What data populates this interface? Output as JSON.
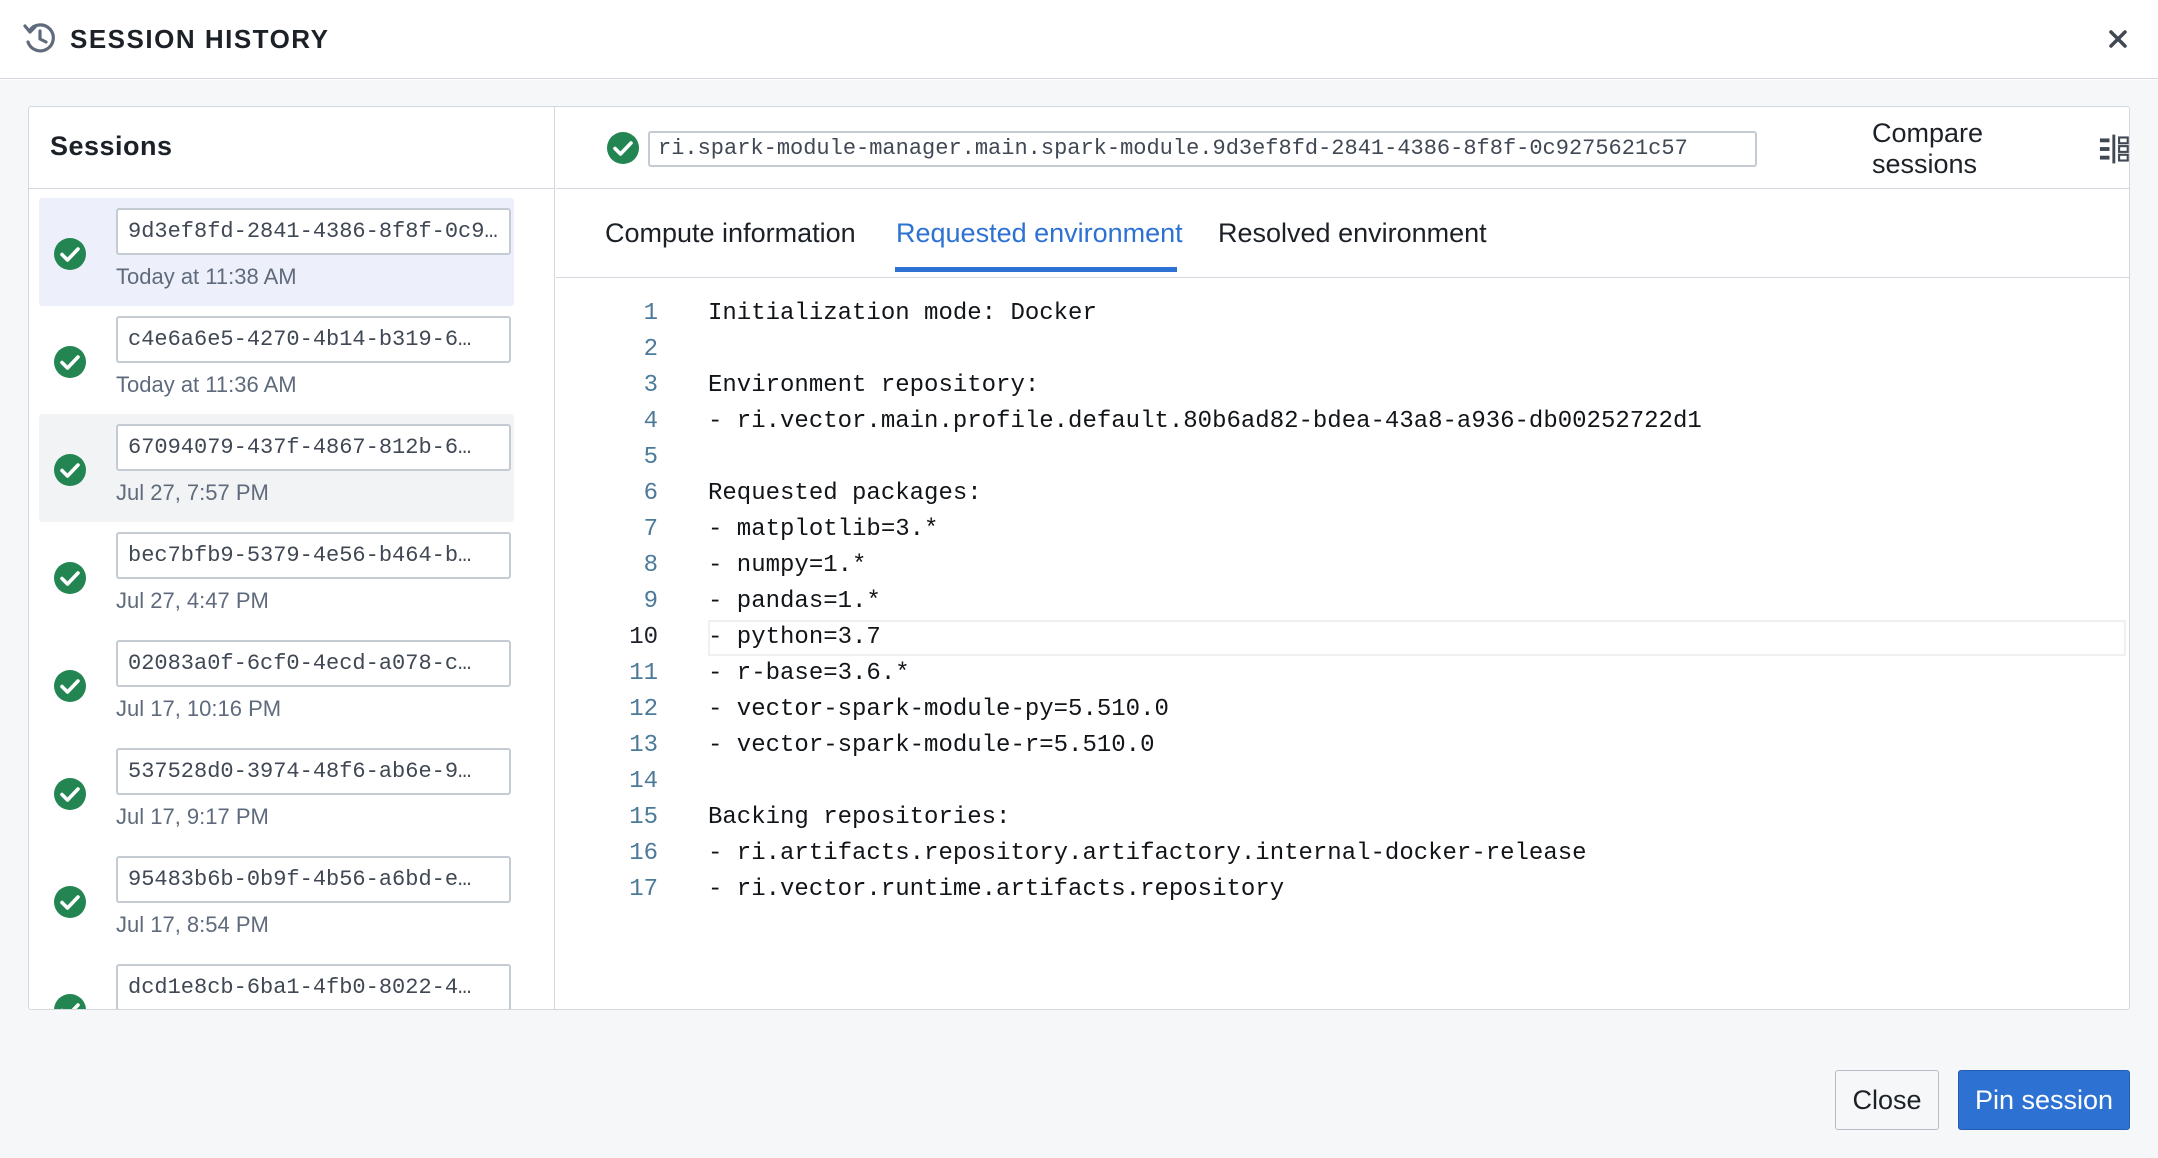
{
  "header": {
    "title": "SESSION HISTORY",
    "icon": "history-icon",
    "close_icon": "close-icon"
  },
  "sidebar": {
    "title": "Sessions",
    "sessions": [
      {
        "id": "9d3ef8fd-2841-4386-8f8f-0c9275621c57",
        "time": "Today at 11:38 AM",
        "status": "success",
        "selected": true
      },
      {
        "id": "c4e6a6e5-4270-4b14-b319-6…",
        "time": "Today at 11:36 AM",
        "status": "success"
      },
      {
        "id": "67094079-437f-4867-812b-6…",
        "time": "Jul 27, 7:57 PM",
        "status": "success",
        "hovered": true
      },
      {
        "id": "bec7bfb9-5379-4e56-b464-b…",
        "time": "Jul 27, 4:47 PM",
        "status": "success"
      },
      {
        "id": "02083a0f-6cf0-4ecd-a078-c…",
        "time": "Jul 17, 10:16 PM",
        "status": "success"
      },
      {
        "id": "537528d0-3974-48f6-ab6e-9…",
        "time": "Jul 17, 9:17 PM",
        "status": "success"
      },
      {
        "id": "95483b6b-0b9f-4b56-a6bd-e…",
        "time": "Jul 17, 8:54 PM",
        "status": "success"
      },
      {
        "id": "dcd1e8cb-6ba1-4fb0-8022-4…",
        "time": "",
        "status": "success"
      }
    ]
  },
  "main": {
    "resource_id": "ri.spark-module-manager.main.spark-module.9d3ef8fd-2841-4386-8f8f-0c9275621c57",
    "compare_label": "Compare sessions",
    "tabs": [
      {
        "label": "Compute information"
      },
      {
        "label": "Requested environment",
        "active": true
      },
      {
        "label": "Resolved environment"
      }
    ],
    "current_line": 10,
    "code_lines": [
      "Initialization mode: Docker",
      "",
      "Environment repository:",
      "- ri.vector.main.profile.default.80b6ad82-bdea-43a8-a936-db00252722d1",
      "",
      "Requested packages:",
      "- matplotlib=3.*",
      "- numpy=1.*",
      "- pandas=1.*",
      "- python=3.7",
      "- r-base=3.6.*",
      "- vector-spark-module-py=5.510.0",
      "- vector-spark-module-r=5.510.0",
      "",
      "Backing repositories:",
      "- ri.artifacts.repository.artifactory.internal-docker-release",
      "- ri.vector.runtime.artifacts.repository"
    ]
  },
  "footer": {
    "close_label": "Close",
    "pin_label": "Pin session"
  },
  "colors": {
    "accent": "#2d72d2",
    "success": "#238551",
    "selected_bg": "#edf0fa"
  }
}
